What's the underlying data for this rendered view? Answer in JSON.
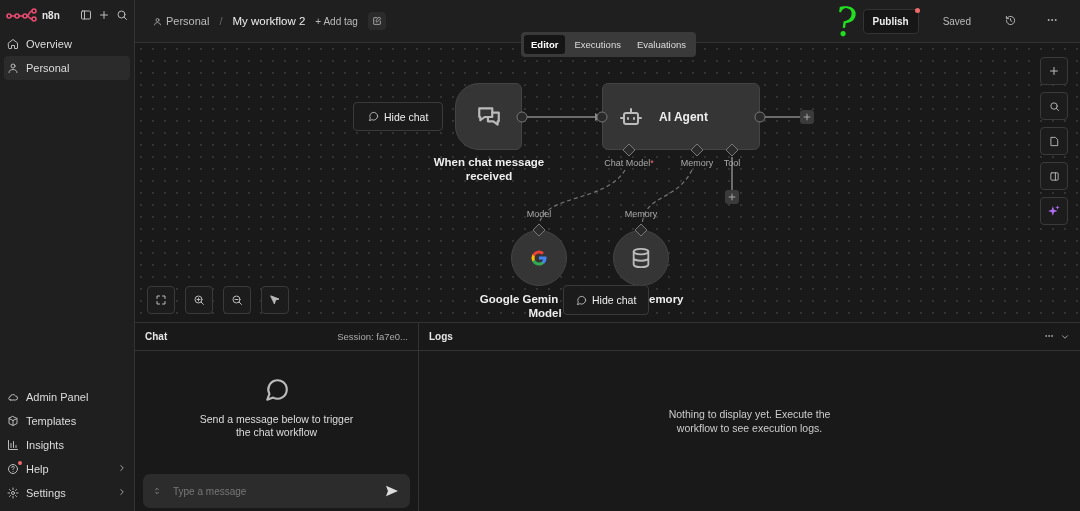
{
  "sidebar": {
    "logo": "n8n",
    "items": [
      {
        "label": "Overview",
        "selected": false
      },
      {
        "label": "Personal",
        "selected": true
      }
    ],
    "bottom_items": [
      {
        "label": "Admin Panel",
        "chevron": false,
        "notification": false
      },
      {
        "label": "Templates",
        "chevron": false,
        "notification": false
      },
      {
        "label": "Insights",
        "chevron": false,
        "notification": false
      },
      {
        "label": "Help",
        "chevron": true,
        "notification": true
      },
      {
        "label": "Settings",
        "chevron": true,
        "notification": false
      }
    ]
  },
  "header": {
    "breadcrumb": "Personal",
    "separator": "/",
    "workflow_name": "My workflow 2",
    "add_tag": "+ Add tag",
    "publish": {
      "label": "Publish",
      "notification": true
    },
    "status": "Saved"
  },
  "tabs": [
    {
      "label": "Editor",
      "selected": true
    },
    {
      "label": "Executions",
      "selected": false
    },
    {
      "label": "Evaluations",
      "selected": false
    }
  ],
  "annotation": {
    "text": "?",
    "color": "#22dd22"
  },
  "canvas": {
    "hide_chat_buttons": [
      "Hide chat",
      "Hide chat"
    ],
    "trigger": {
      "label_lines": [
        "When chat message",
        "received"
      ]
    },
    "agent": {
      "title": "AI Agent",
      "inputs": [
        {
          "label": "Chat Model",
          "required_mark": "*"
        },
        {
          "label": "Memory"
        },
        {
          "label": "Tool"
        }
      ]
    },
    "sub_nodes": [
      {
        "kind": "gemini",
        "port": "Model",
        "label_lines": [
          "Google Gemin",
          "Model"
        ]
      },
      {
        "kind": "memory",
        "port": "Memory",
        "label_lines": [
          "emory"
        ]
      }
    ]
  },
  "chat": {
    "title": "Chat",
    "session": "Session: fa7e0...",
    "empty_text": "Send a message below to trigger the chat workflow",
    "placeholder": "Type a message"
  },
  "logs": {
    "title": "Logs",
    "empty_text": "Nothing to display yet. Execute the workflow to see execution logs."
  }
}
